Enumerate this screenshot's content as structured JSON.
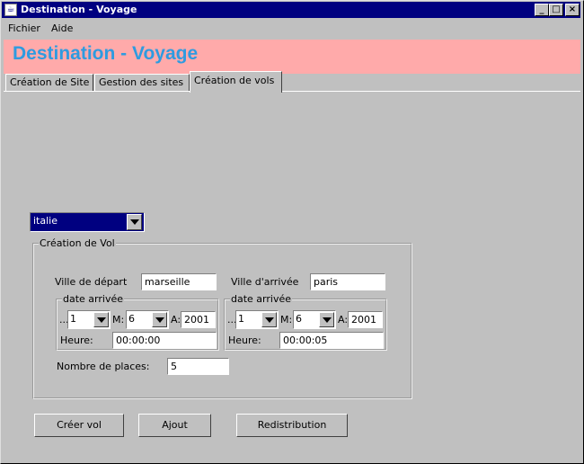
{
  "window": {
    "title": "Destination - Voyage"
  },
  "menu": {
    "file": "Fichier",
    "help": "Aide"
  },
  "banner": {
    "title": "Destination - Voyage"
  },
  "tabs": [
    {
      "label": "Création de Site"
    },
    {
      "label": "Gestion des sites"
    },
    {
      "label": "Création de vols"
    }
  ],
  "country_select": {
    "value": "italie"
  },
  "flight_group": {
    "legend": "Création de Vol",
    "departure_label": "Ville de départ",
    "departure_value": "marseille",
    "arrival_label": "Ville d'arrivée",
    "arrival_value": "paris",
    "left_date": {
      "legend": "date arrivée",
      "j_label": "...",
      "day": "1",
      "m_label": "M:",
      "month": "6",
      "a_label": "A:",
      "year": "2001",
      "time_label": "Heure:",
      "time": "00:00:00"
    },
    "right_date": {
      "legend": "date arrivée",
      "j_label": "...",
      "day": "1",
      "m_label": "M:",
      "month": "6",
      "a_label": "A:",
      "year": "2001",
      "time_label": "Heure:",
      "time": "00:00:05"
    },
    "places_label": "Nombre de places:",
    "places_value": "5"
  },
  "buttons": {
    "create": "Créer vol",
    "add": "Ajout",
    "redistribute": "Redistribution"
  }
}
